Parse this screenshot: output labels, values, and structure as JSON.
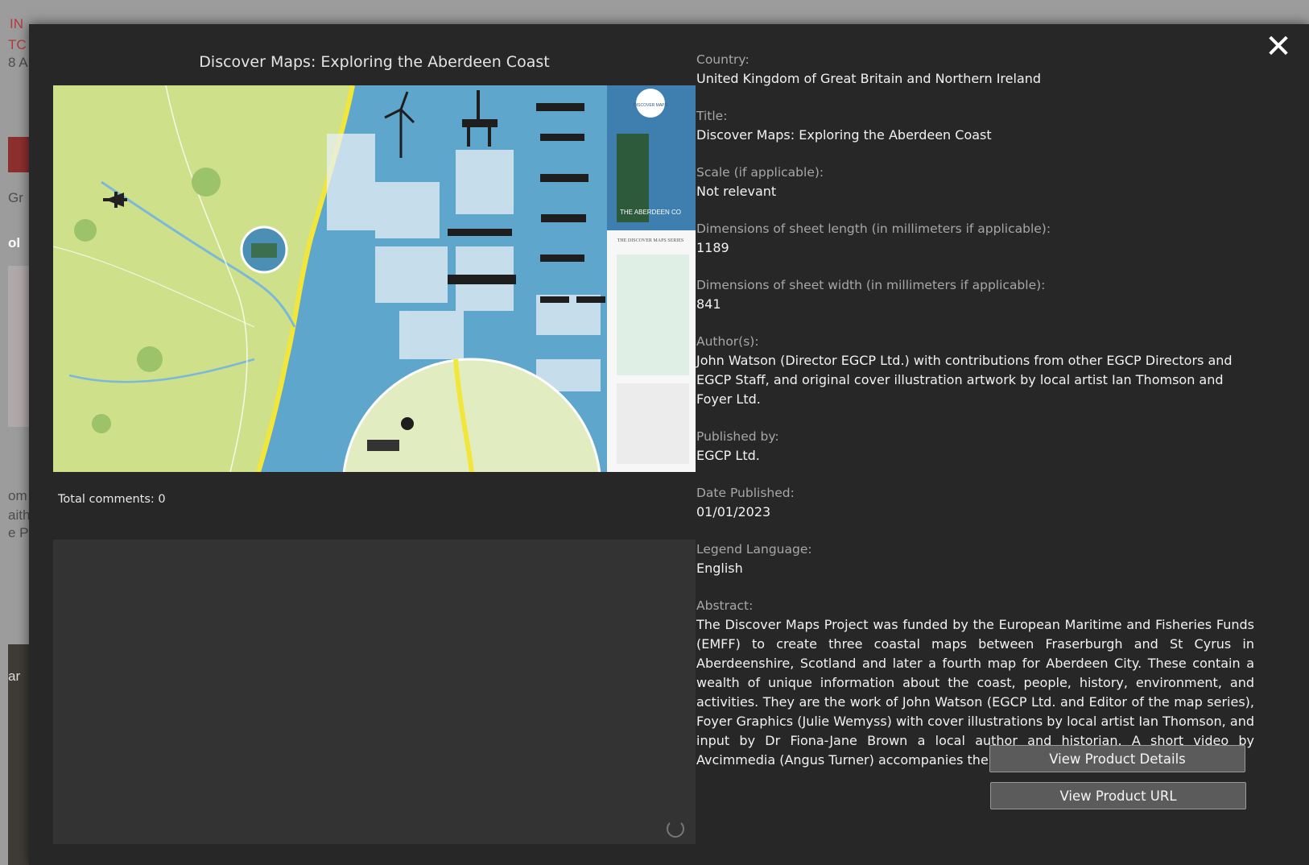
{
  "background": {
    "fragments": [
      "IN",
      "TC",
      "8 A",
      "Gr",
      "ol",
      "om",
      "aith",
      "e P",
      "ar"
    ]
  },
  "modal": {
    "close_label": "✕",
    "map_title": "Discover Maps: Exploring the Aberdeen Coast",
    "map_image_texts": [
      "DISCOVER MAPS",
      "THE ABERDEEN CO",
      "THE DISCOVER MAPS SERIES"
    ],
    "total_comments": "Total comments: 0",
    "fields": [
      {
        "label": "Country:",
        "value": "United Kingdom of Great Britain and Northern Ireland"
      },
      {
        "label": "Title:",
        "value": "Discover Maps: Exploring the Aberdeen Coast"
      },
      {
        "label": "Scale (if applicable):",
        "value": "Not relevant"
      },
      {
        "label": "Dimensions of sheet length (in millimeters if applicable):",
        "value": "1189"
      },
      {
        "label": "Dimensions of sheet width (in millimeters if applicable):",
        "value": "841"
      },
      {
        "label": "Author(s):",
        "value": "John Watson (Director EGCP Ltd.) with contributions from other EGCP Directors and EGCP Staff, and original cover illustration artwork by local artist Ian Thomson and Foyer Ltd."
      },
      {
        "label": "Published by:",
        "value": "EGCP Ltd."
      },
      {
        "label": "Date Published:",
        "value": "01/01/2023"
      },
      {
        "label": "Legend Language:",
        "value": "English"
      },
      {
        "label": "Abstract:",
        "value": "The Discover Maps Project was funded by the European Maritime and Fisheries Funds (EMFF) to create three coastal maps between Fraserburgh and St Cyrus in Aberdeenshire, Scotland and later a fourth map for Aberdeen City. These contain a wealth of unique information about the coast, people, history, environment, and activities. They are the work of John Watson (EGCP Ltd. and Editor of the map series), Foyer Graphics (Julie Wemyss) with cover illustrations by local artist Ian Thomson, and input by Dr Fiona-Jane Brown a local author and historian. A short video by Avcimmedia (Angus Turner) accompanies the maps."
      }
    ],
    "buttons": {
      "view_details": "View Product Details",
      "view_url": "View Product URL"
    }
  }
}
